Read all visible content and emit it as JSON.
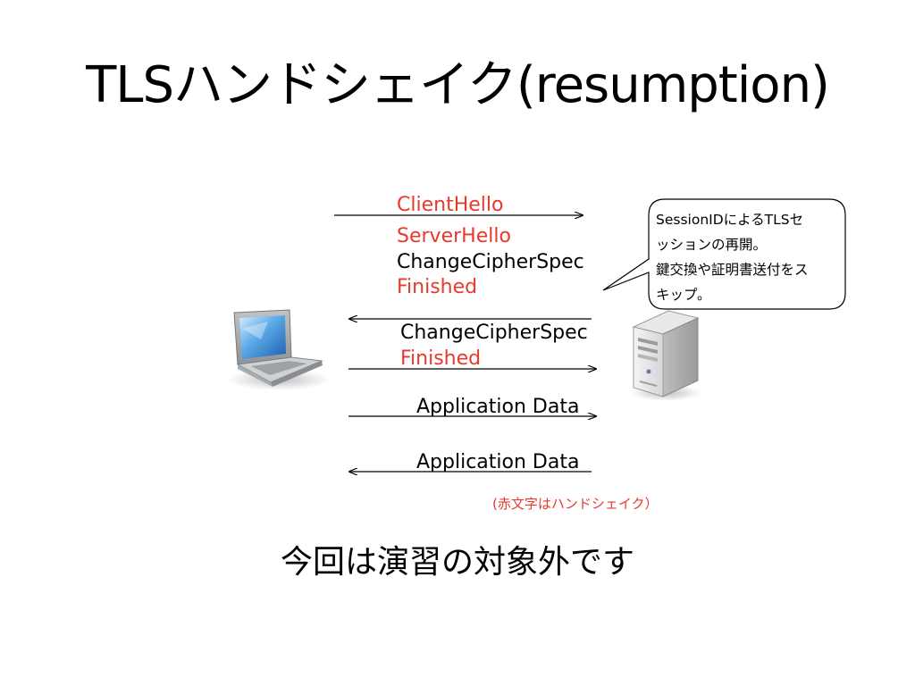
{
  "slide": {
    "title": "TLSハンドシェイク(resumption)",
    "footer": "今回は演習の対象外です"
  },
  "messages": {
    "client_hello": "ClientHello",
    "server_hello": "ServerHello",
    "change_cipher_spec_server": "ChangeCipherSpec",
    "finished_server": "Finished",
    "change_cipher_spec_client": "ChangeCipherSpec",
    "finished_client": "Finished",
    "app_data_1": "Application Data",
    "app_data_2": "Application Data"
  },
  "callout": {
    "line1": "SessionIDによるTLSセ",
    "line2": "ッションの再開。",
    "line3": "鍵交換や証明書送付をス",
    "line4": "キップ。"
  },
  "note": "(赤文字はハンドシェイク）",
  "colors": {
    "handshake_red": "#e8392c",
    "text": "#000000"
  },
  "icons": {
    "client": "laptop-icon",
    "server": "server-icon"
  }
}
